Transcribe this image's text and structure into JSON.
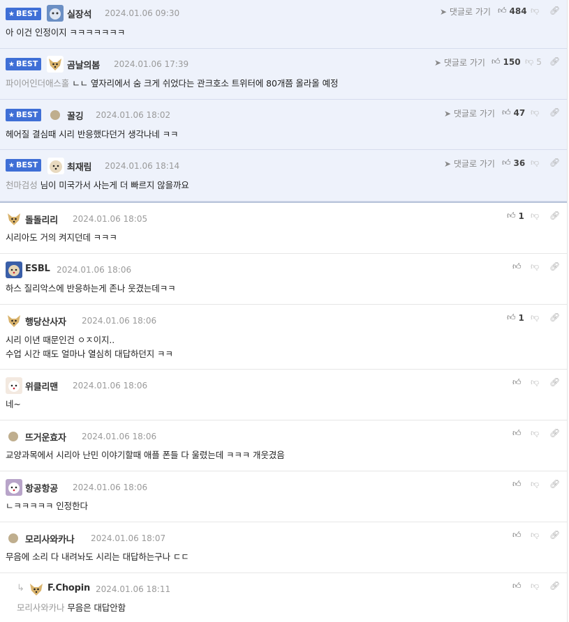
{
  "best_label": "BEST",
  "reply_link_label": "댓글로 가기",
  "best_comments": [
    {
      "nick": "실장석",
      "date": "2024.01.06 09:30",
      "text": "아 이건 인정이지 ㅋㅋㅋㅋㅋㅋㅋ",
      "ref": "",
      "likes": "484",
      "dislikes": ""
    },
    {
      "nick": "곰날의봄",
      "date": "2024.01.06 17:39",
      "text": "ㄴㄴ 옆자리에서 숨 크게 쉬었다는 관크호소 트위터에 80개쯤 올라올 예정",
      "ref": "파이어인더애스홀",
      "likes": "150",
      "dislikes": "5"
    },
    {
      "nick": "꿀깅",
      "date": "2024.01.06 18:02",
      "text": "헤어질 결심때 시리 반응했다던거 생각나네 ㅋㅋ",
      "ref": "",
      "likes": "47",
      "dislikes": ""
    },
    {
      "nick": "최재림",
      "date": "2024.01.06 18:14",
      "text": "님이 미국가서 사는게 더 빠르지 않을까요",
      "ref": "천마검성",
      "likes": "36",
      "dislikes": ""
    }
  ],
  "comments": [
    {
      "nick": "돌돌리리",
      "date": "2024.01.06 18:05",
      "lines": [
        "시리아도 거의 켜지던데 ㅋㅋㅋ"
      ],
      "likes": "1"
    },
    {
      "nick": "ESBL",
      "date": "2024.01.06 18:06",
      "lines": [
        "하스 질리악스에 반응하는게 존나 웃겼는데ㅋㅋ"
      ],
      "likes": ""
    },
    {
      "nick": "행당산사자",
      "date": "2024.01.06 18:06",
      "lines": [
        "시리 이년 때문인건 ㅇㅈ이지..",
        "수업 시간 때도 얼마나 열심히 대답하던지 ㅋㅋ"
      ],
      "likes": "1"
    },
    {
      "nick": "위클리맨",
      "date": "2024.01.06 18:06",
      "lines": [
        "네~"
      ],
      "likes": ""
    },
    {
      "nick": "뜨거운효자",
      "date": "2024.01.06 18:06",
      "lines": [
        "교양과목에서 시리아 난민 이야기할때 애플 폰들 다 울렸는데 ㅋㅋㅋ 개웃겼음"
      ],
      "likes": ""
    },
    {
      "nick": "항공항공",
      "date": "2024.01.06 18:06",
      "lines": [
        "ㄴㅋㅋㅋㅋㅋ 인정한다"
      ],
      "likes": ""
    },
    {
      "nick": "모리사와카나",
      "date": "2024.01.06 18:07",
      "lines": [
        "무음에 소리 다 내려놔도 시리는 대답하는구나 ㄷㄷ"
      ],
      "likes": ""
    }
  ],
  "reply": {
    "nick": "F.Chopin",
    "date": "2024.01.06 18:11",
    "ref": "모리사와카나",
    "text": "무음은 대답안함",
    "likes": ""
  }
}
